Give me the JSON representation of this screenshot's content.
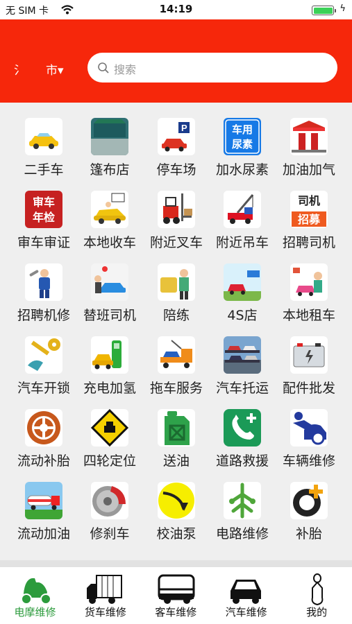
{
  "status_bar": {
    "carrier": "无 SIM 卡",
    "time": "14:19",
    "charging": "ϟ"
  },
  "header": {
    "city_prefix": "氵",
    "city": "市▾"
  },
  "search": {
    "placeholder": "搜索"
  },
  "services": [
    {
      "label": "二手车",
      "icon": "used-car-icon"
    },
    {
      "label": "篷布店",
      "icon": "tarp-truck-icon"
    },
    {
      "label": "停车场",
      "icon": "parking-icon"
    },
    {
      "label": "加水尿素",
      "icon": "urea-icon",
      "icon_text": [
        "车用",
        "尿素"
      ]
    },
    {
      "label": "加油加气",
      "icon": "gas-station-icon"
    },
    {
      "label": "审车审证",
      "icon": "inspection-icon",
      "icon_text": [
        "审车",
        "年检"
      ]
    },
    {
      "label": "本地收车",
      "icon": "car-purchase-icon"
    },
    {
      "label": "附近叉车",
      "icon": "forklift-icon"
    },
    {
      "label": "附近吊车",
      "icon": "crane-icon"
    },
    {
      "label": "招聘司机",
      "icon": "driver-recruit-icon",
      "icon_text": [
        "司机",
        "招募"
      ]
    },
    {
      "label": "招聘机修",
      "icon": "mechanic-icon"
    },
    {
      "label": "替班司机",
      "icon": "substitute-driver-icon"
    },
    {
      "label": "陪练",
      "icon": "driving-coach-icon"
    },
    {
      "label": "4S店",
      "icon": "dealership-icon"
    },
    {
      "label": "本地租车",
      "icon": "car-rental-icon"
    },
    {
      "label": "汽车开锁",
      "icon": "car-key-icon"
    },
    {
      "label": "充电加氢",
      "icon": "ev-charger-icon"
    },
    {
      "label": "拖车服务",
      "icon": "tow-truck-icon"
    },
    {
      "label": "汽车托运",
      "icon": "car-carrier-icon"
    },
    {
      "label": "配件批发",
      "icon": "battery-icon"
    },
    {
      "label": "流动补胎",
      "icon": "tire-icon"
    },
    {
      "label": "四轮定位",
      "icon": "alignment-icon"
    },
    {
      "label": "送油",
      "icon": "jerrycan-icon"
    },
    {
      "label": "道路救援",
      "icon": "rescue-phone-icon"
    },
    {
      "label": "车辆维修",
      "icon": "repair-icon"
    },
    {
      "label": "流动加油",
      "icon": "fuel-tanker-icon"
    },
    {
      "label": "修刹车",
      "icon": "brake-disc-icon"
    },
    {
      "label": "校油泵",
      "icon": "fuel-pump-icon"
    },
    {
      "label": "电路维修",
      "icon": "circuit-icon"
    },
    {
      "label": "补胎",
      "icon": "tire-plus-icon"
    }
  ],
  "tabs": [
    {
      "label": "电摩维修",
      "icon": "scooter-icon",
      "active": true
    },
    {
      "label": "货车维修",
      "icon": "truck-icon",
      "active": false
    },
    {
      "label": "客车维修",
      "icon": "bus-icon",
      "active": false
    },
    {
      "label": "汽车维修",
      "icon": "car-icon",
      "active": false
    },
    {
      "label": "我的",
      "icon": "person-icon",
      "active": false
    }
  ],
  "colors": {
    "header_red": "#f6270b",
    "active_green": "#2c9b3c"
  }
}
